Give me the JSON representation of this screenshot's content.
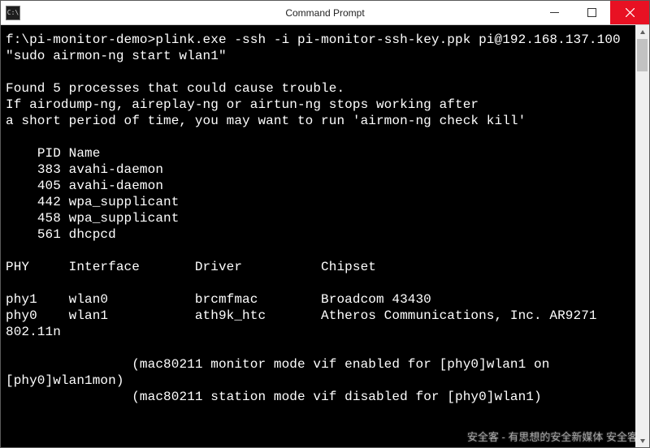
{
  "window": {
    "sysicon_label": "C:\\",
    "title": "Command Prompt"
  },
  "terminal": {
    "prompt": "f:\\pi-monitor-demo>",
    "command": "plink.exe -ssh -i pi-monitor-ssh-key.ppk pi@192.168.137.100 \"sudo airmon-ng start wlan1\"",
    "output": {
      "warn1": "Found 5 processes that could cause trouble.",
      "warn2": "If airodump-ng, aireplay-ng or airtun-ng stops working after",
      "warn3": "a short period of time, you may want to run 'airmon-ng check kill'",
      "proc_header": "    PID Name",
      "processes": [
        "    383 avahi-daemon",
        "    405 avahi-daemon",
        "    442 wpa_supplicant",
        "    458 wpa_supplicant",
        "    561 dhcpcd"
      ],
      "iface_header": "PHY     Interface       Driver          Chipset",
      "ifaces": [
        "phy1    wlan0           brcmfmac        Broadcom 43430",
        "phy0    wlan1           ath9k_htc       Atheros Communications, Inc. AR9271 802.11n"
      ],
      "status1": "                (mac80211 monitor mode vif enabled for [phy0]wlan1 on [phy0]wlan1mon)",
      "status2": "                (mac80211 station mode vif disabled for [phy0]wlan1)"
    }
  },
  "watermark": "安全客 - 有思想的安全新媒体 安全客"
}
